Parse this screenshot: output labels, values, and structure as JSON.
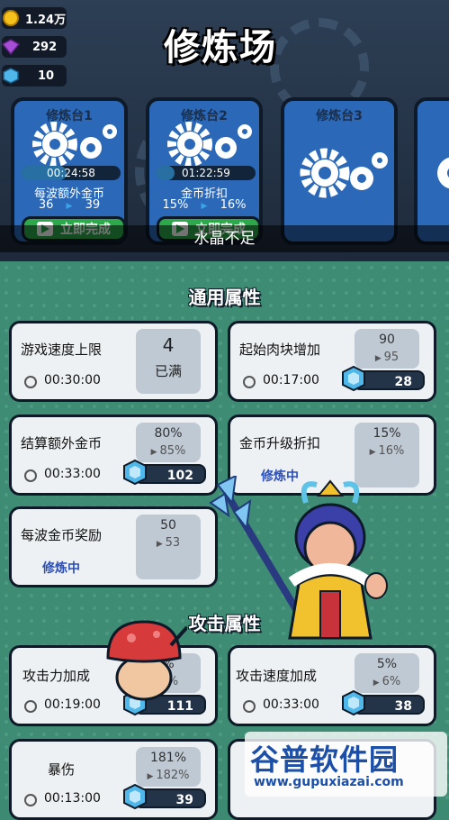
{
  "resources": {
    "coins": "1.24万",
    "gems": "292",
    "crystals": "10"
  },
  "title": "修炼场",
  "stations": [
    {
      "name": "修炼台1",
      "timer": "00:24:58",
      "progress": 0.45,
      "attr": "每波额外金币",
      "from": "36",
      "to": "39",
      "button": "立即完成"
    },
    {
      "name": "修炼台2",
      "timer": "01:22:59",
      "progress": 0.18,
      "attr": "金币折扣",
      "from": "15%",
      "to": "16%",
      "button": "立即完成"
    },
    {
      "name": "修炼台3"
    }
  ],
  "toast": "水晶不足",
  "general_title": "通用属性",
  "attack_title": "攻击属性",
  "attributes": [
    {
      "label": "游戏速度上限",
      "time": "00:30:00",
      "value": "4",
      "status": "已满"
    },
    {
      "label": "起始肉块增加",
      "time": "00:17:00",
      "from": "90",
      "to": "95",
      "cost": "28"
    },
    {
      "label": "结算额外金币",
      "time": "00:33:00",
      "from": "80%",
      "to": "85%",
      "cost": "102"
    },
    {
      "label": "金币升级折扣",
      "status": "修炼中",
      "from": "15%",
      "to": "16%"
    },
    {
      "label": "每波金币奖励",
      "status": "修炼中",
      "from": "50",
      "to": "53"
    },
    {
      "label": "攻击力加成",
      "time": "00:19:00",
      "from": "%",
      "to": "%",
      "cost": "111"
    },
    {
      "label": "攻击速度加成",
      "time": "00:33:00",
      "from": "5%",
      "to": "6%",
      "cost": "38"
    },
    {
      "label": "暴伤",
      "time": "00:13:00",
      "from": "181%",
      "to": "182%",
      "cost": "39"
    }
  ],
  "watermark": {
    "name": "谷普软件园",
    "url": "www.gupuxiazai.com"
  },
  "colors": {
    "accent_blue": "#2b69b8",
    "button_green": "#2da84a",
    "bg_green": "#3f8c74"
  }
}
